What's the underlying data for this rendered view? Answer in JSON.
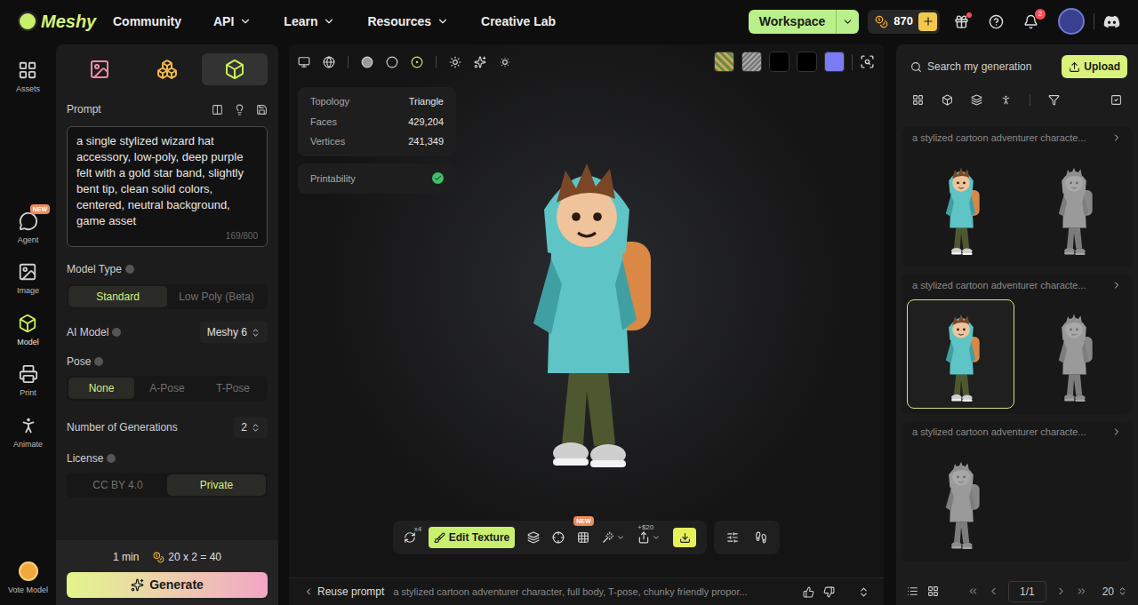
{
  "header": {
    "logo": "Meshy",
    "nav": [
      {
        "label": "Community",
        "dropdown": false
      },
      {
        "label": "API",
        "dropdown": true
      },
      {
        "label": "Learn",
        "dropdown": true
      },
      {
        "label": "Resources",
        "dropdown": true
      },
      {
        "label": "Creative Lab",
        "dropdown": false
      }
    ],
    "workspace_button": "Workspace",
    "credits": "870",
    "gift_dot": true,
    "notifications_badge": "2"
  },
  "rail": {
    "items": [
      {
        "label": "Assets",
        "kind": "assets",
        "badge": "",
        "selected": false
      },
      {
        "label": "Agent",
        "kind": "agent",
        "badge": "NEW",
        "selected": false
      },
      {
        "label": "Image",
        "kind": "image",
        "badge": "",
        "selected": false
      },
      {
        "label": "Model",
        "kind": "model",
        "badge": "",
        "selected": true
      },
      {
        "label": "Print",
        "kind": "print",
        "badge": "",
        "selected": false
      },
      {
        "label": "Animate",
        "kind": "animate",
        "badge": "",
        "selected": false
      }
    ],
    "bottom": {
      "label": "Vote Model"
    }
  },
  "left_panel": {
    "mode_tabs": [
      {
        "kind": "image",
        "selected": false
      },
      {
        "kind": "multi",
        "selected": false
      },
      {
        "kind": "model",
        "selected": true
      }
    ],
    "prompt": {
      "label": "Prompt",
      "value": "a single stylized wizard hat accessory, low-poly, deep purple felt with a gold star band, slightly bent tip, clean solid colors, centered, neutral background, game asset",
      "counter": "169/800"
    },
    "model_type": {
      "label": "Model Type",
      "options": [
        {
          "label": "Standard",
          "selected": true
        },
        {
          "label": "Low Poly (Beta)",
          "selected": false
        }
      ]
    },
    "ai_model": {
      "label": "AI Model",
      "value": "Meshy 6"
    },
    "pose": {
      "label": "Pose",
      "options": [
        {
          "label": "None",
          "selected": true
        },
        {
          "label": "A-Pose",
          "selected": false
        },
        {
          "label": "T-Pose",
          "selected": false
        }
      ]
    },
    "generations": {
      "label": "Number of Generations",
      "value": "2"
    },
    "license": {
      "label": "License",
      "options": [
        {
          "label": "CC BY 4.0",
          "selected": false
        },
        {
          "label": "Private",
          "selected": true
        }
      ]
    },
    "footer": {
      "time": "1 min",
      "cost": "20 x 2 = 40",
      "generate": "Generate"
    }
  },
  "viewport": {
    "shading_modes": [
      {
        "selected": false
      },
      {
        "selected": false
      },
      {
        "selected": true
      }
    ],
    "swatches": [
      {
        "kind": "texture",
        "color": "#6b8a4a"
      },
      {
        "kind": "matcap",
        "color": "#8a8a8a"
      },
      {
        "kind": "solid",
        "color": "#000000"
      },
      {
        "kind": "solid",
        "color": "#000000"
      },
      {
        "kind": "solid",
        "color": "#7b7bf5"
      }
    ],
    "stats": [
      {
        "label": "Topology",
        "value": "Triangle"
      },
      {
        "label": "Faces",
        "value": "429,204"
      },
      {
        "label": "Vertices",
        "value": "241,349"
      }
    ],
    "printability": {
      "label": "Printability",
      "ok": true
    },
    "toolbar": {
      "refresh_count": "x4",
      "edit_texture": "Edit Texture",
      "new_badge": "NEW",
      "price": "+$20"
    },
    "prompt_bar": {
      "reuse": "Reuse prompt",
      "text": "a stylized cartoon adventurer character, full body, T-pose, chunky friendly propor..."
    }
  },
  "right_panel": {
    "search_placeholder": "Search my generation",
    "upload": "Upload",
    "groups": [
      {
        "title": "a stylized cartoon adventurer characte...",
        "thumbs": [
          {
            "kind": "textured",
            "selected": false
          },
          {
            "kind": "untextured",
            "selected": false
          }
        ]
      },
      {
        "title": "a stylized cartoon adventurer characte...",
        "thumbs": [
          {
            "kind": "textured",
            "selected": true
          },
          {
            "kind": "untextured",
            "selected": false
          }
        ]
      },
      {
        "title": "a stylized cartoon adventurer characte...",
        "thumbs": [
          {
            "kind": "untextured",
            "selected": false
          }
        ]
      }
    ],
    "pagination": {
      "page": "1/1",
      "page_size": "20"
    }
  }
}
